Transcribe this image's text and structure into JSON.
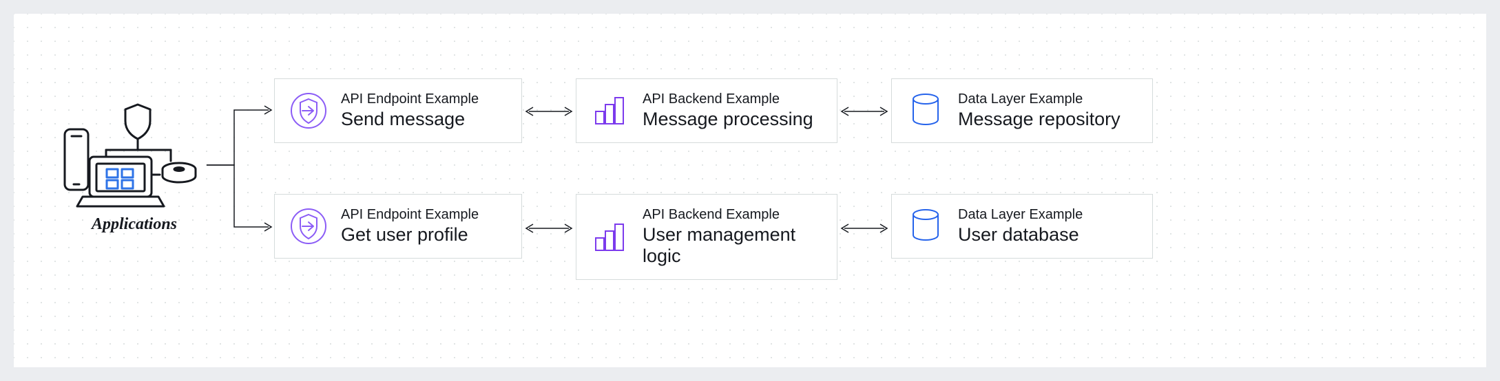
{
  "applications_label": "Applications",
  "rows": [
    {
      "endpoint": {
        "subtitle": "API Endpoint Example",
        "title": "Send message"
      },
      "backend": {
        "subtitle": "API Backend Example",
        "title": "Message processing"
      },
      "data": {
        "subtitle": "Data Layer Example",
        "title": "Message repository"
      }
    },
    {
      "endpoint": {
        "subtitle": "API Endpoint Example",
        "title": "Get user profile"
      },
      "backend": {
        "subtitle": "API Backend Example",
        "title": "User management logic"
      },
      "data": {
        "subtitle": "Data Layer Example",
        "title": "User database"
      }
    }
  ],
  "colors": {
    "endpoint_icon": "#7B68EE",
    "backend_icon": "#7B5CFF",
    "data_icon": "#2E73E7"
  }
}
